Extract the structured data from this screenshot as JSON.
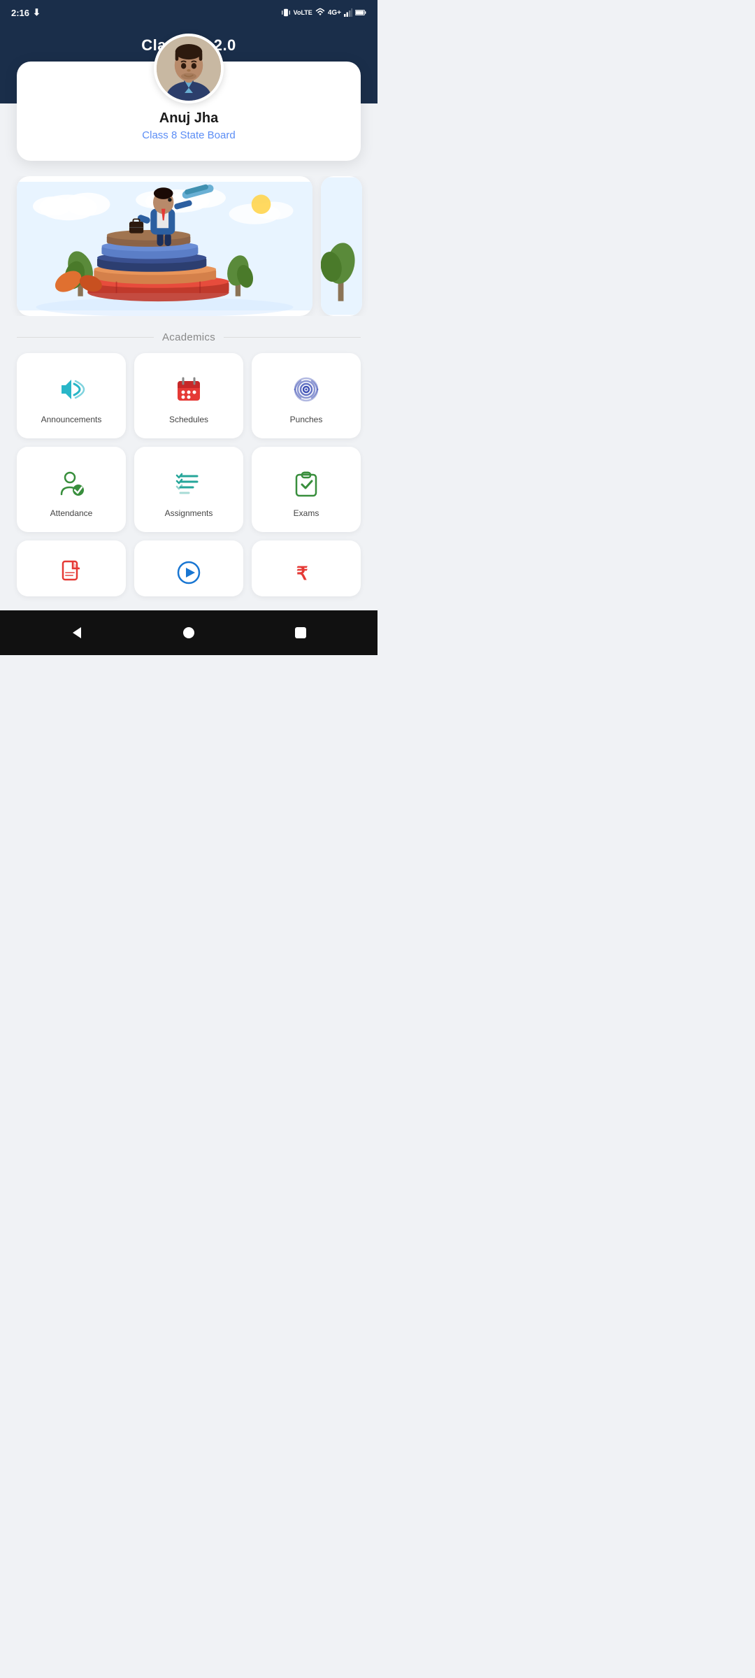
{
  "statusBar": {
    "time": "2:16",
    "downloadIcon": "↓",
    "vibrate": "📳",
    "volte": "VoLTE",
    "wifi": "wifi",
    "network": "4G+",
    "signal": "signal",
    "battery": "battery"
  },
  "header": {
    "title": "Classbot 2.0"
  },
  "profile": {
    "name": "Anuj Jha",
    "class": "Class 8 State Board"
  },
  "sectionTitle": "Academics",
  "gridItems": [
    {
      "id": "announcements",
      "label": "Announcements",
      "iconColor": "#29b6c8"
    },
    {
      "id": "schedules",
      "label": "Schedules",
      "iconColor": "#e53935"
    },
    {
      "id": "punches",
      "label": "Punches",
      "iconColor": "#3f51b5"
    },
    {
      "id": "attendance",
      "label": "Attendance",
      "iconColor": "#388e3c"
    },
    {
      "id": "assignments",
      "label": "Assignments",
      "iconColor": "#26a69a"
    },
    {
      "id": "exams",
      "label": "Exams",
      "iconColor": "#388e3c"
    }
  ],
  "partialItems": [
    {
      "id": "document",
      "iconColor": "#e53935"
    },
    {
      "id": "play",
      "iconColor": "#1976d2"
    },
    {
      "id": "rupee",
      "iconColor": "#e53935"
    }
  ],
  "nav": {
    "back": "◀",
    "home": "⬤",
    "recent": "■"
  }
}
